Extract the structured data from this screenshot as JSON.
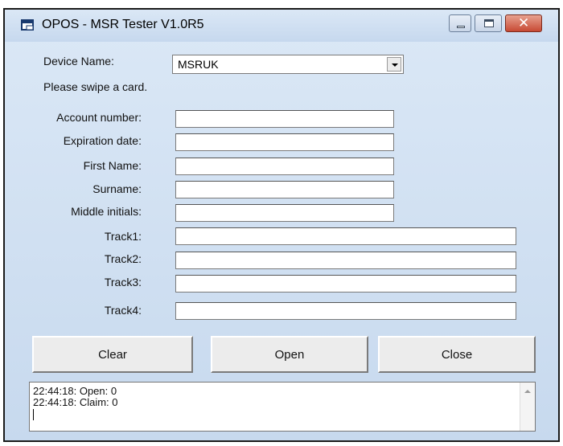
{
  "window": {
    "title": "OPOS - MSR Tester V1.0R5"
  },
  "device": {
    "label": "Device Name:",
    "value": "MSRUK"
  },
  "status": {
    "prompt": "Please swipe a card."
  },
  "fields": {
    "account_label": "Account number:",
    "expiration_label": "Expiration date:",
    "first_name_label": "First Name:",
    "surname_label": "Surname:",
    "middle_label": "Middle initials:",
    "track1_label": "Track1:",
    "track2_label": "Track2:",
    "track3_label": "Track3:",
    "track4_label": "Track4:"
  },
  "buttons": {
    "clear": "Clear",
    "open": "Open",
    "close": "Close"
  },
  "log": {
    "lines": [
      "22:44:18: Open: 0",
      "22:44:18: Claim: 0"
    ]
  },
  "icons": {
    "app": "app-window-icon",
    "minimize": "minimize-icon",
    "maximize": "maximize-icon",
    "close": "close-icon",
    "dropdown": "chevron-down-icon",
    "scroll_up": "scroll-up-icon"
  }
}
